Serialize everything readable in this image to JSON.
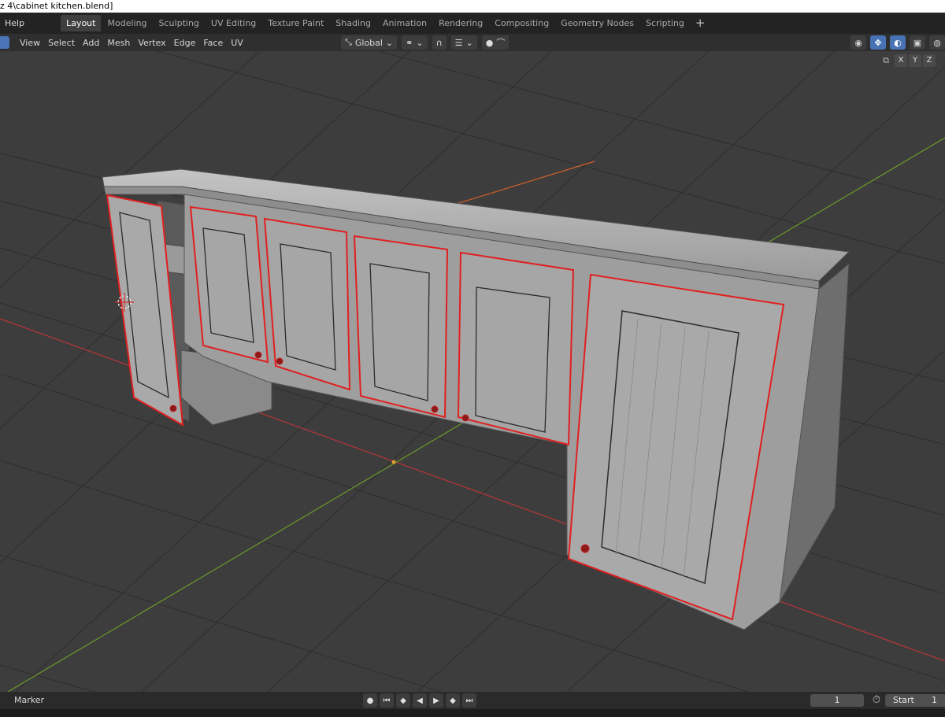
{
  "window": {
    "title": "z 4\\cabinet kitchen.blend]"
  },
  "menubar": {
    "help_label": "Help"
  },
  "workspaces": {
    "tabs": [
      "Layout",
      "Modeling",
      "Sculpting",
      "UV Editing",
      "Texture Paint",
      "Shading",
      "Animation",
      "Rendering",
      "Compositing",
      "Geometry Nodes",
      "Scripting"
    ],
    "active": "Layout",
    "add_label": "+"
  },
  "viewport_header": {
    "menus": [
      "View",
      "Select",
      "Add",
      "Mesh",
      "Vertex",
      "Edge",
      "Face",
      "UV"
    ],
    "transform_orientation": "Global"
  },
  "axis_toggles": [
    "X",
    "Y",
    "Z"
  ],
  "timeline": {
    "marker_label": "Marker",
    "current_frame": "1",
    "start_label": "Start",
    "start_value": "1"
  },
  "colors": {
    "accent_blue": "#4772b3",
    "selection_red": "#e02020",
    "x_axis": "#b8353a",
    "y_axis": "#6c9a2b",
    "grid": "#2e2e2e",
    "background": "#3d3d3d"
  }
}
